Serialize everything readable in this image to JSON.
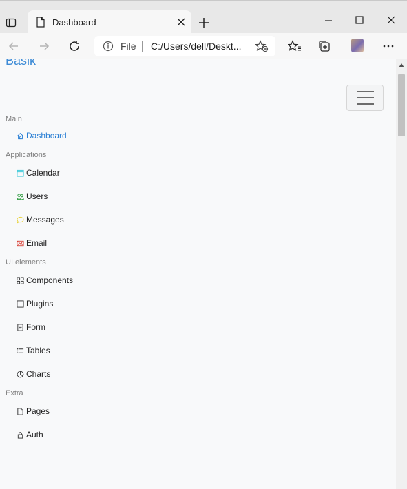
{
  "browser": {
    "tab_title": "Dashboard",
    "address": {
      "file_label": "File",
      "url": "C:/Users/dell/Deskt..."
    }
  },
  "app": {
    "brand": "Basik",
    "sidebar": {
      "sections": [
        {
          "title": "Main",
          "items": [
            {
              "label": "Dashboard",
              "icon": "house-icon",
              "active": true
            }
          ]
        },
        {
          "title": "Applications",
          "items": [
            {
              "label": "Calendar",
              "icon": "calendar-icon"
            },
            {
              "label": "Users",
              "icon": "users-icon"
            },
            {
              "label": "Messages",
              "icon": "chat-icon"
            },
            {
              "label": "Email",
              "icon": "envelope-icon"
            }
          ]
        },
        {
          "title": "UI elements",
          "items": [
            {
              "label": "Components",
              "icon": "grid-icon"
            },
            {
              "label": "Plugins",
              "icon": "square-icon"
            },
            {
              "label": "Form",
              "icon": "form-icon"
            },
            {
              "label": "Tables",
              "icon": "list-icon"
            },
            {
              "label": "Charts",
              "icon": "pie-chart-icon"
            }
          ]
        },
        {
          "title": "Extra",
          "items": [
            {
              "label": "Pages",
              "icon": "page-icon"
            },
            {
              "label": "Auth",
              "icon": "lock-icon"
            }
          ]
        }
      ]
    }
  },
  "colors": {
    "accent": "#2a7fd4",
    "brand": "#3d8bd6",
    "calendar": "#34c8d8",
    "users": "#2d9a3e",
    "messages": "#e8d23a",
    "email": "#d9443a"
  }
}
